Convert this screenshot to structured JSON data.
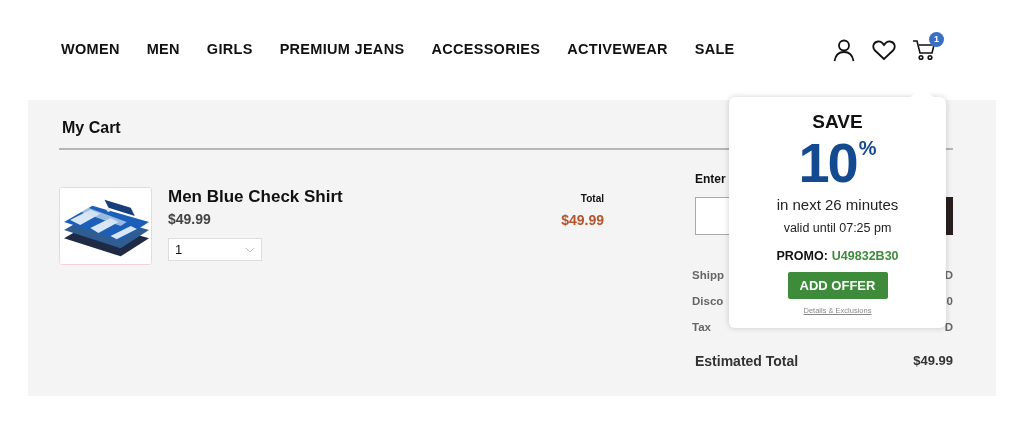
{
  "nav": {
    "items": [
      "WOMEN",
      "MEN",
      "GIRLS",
      "PREMIUM JEANS",
      "ACCESSORIES",
      "ACTIVEWEAR",
      "SALE"
    ],
    "cart_count": "1"
  },
  "cart": {
    "title": "My Cart",
    "items": [
      {
        "kind": "picture",
        "name": "Men Blue Check Shirt",
        "price": "$49.99",
        "quantity": "1",
        "total_label": "Total",
        "total": "$49.99"
      }
    ]
  },
  "summary": {
    "promo_label": "Enter",
    "rows": [
      {
        "label": "Shipp",
        "value": "D"
      },
      {
        "label": "Disco",
        "value": "0"
      },
      {
        "label": "Tax",
        "value": "D"
      }
    ],
    "total_label": "Estimated Total",
    "total": "$49.99"
  },
  "popover": {
    "save": "SAVE",
    "percent": "10",
    "percent_sign": "%",
    "subtitle": "in next 26 minutes",
    "valid": "valid until 07:25 pm",
    "promo_label": "PROMO:",
    "promo_code": "U49832B30",
    "button": "ADD OFFER",
    "link": "Details & Exclusions"
  }
}
